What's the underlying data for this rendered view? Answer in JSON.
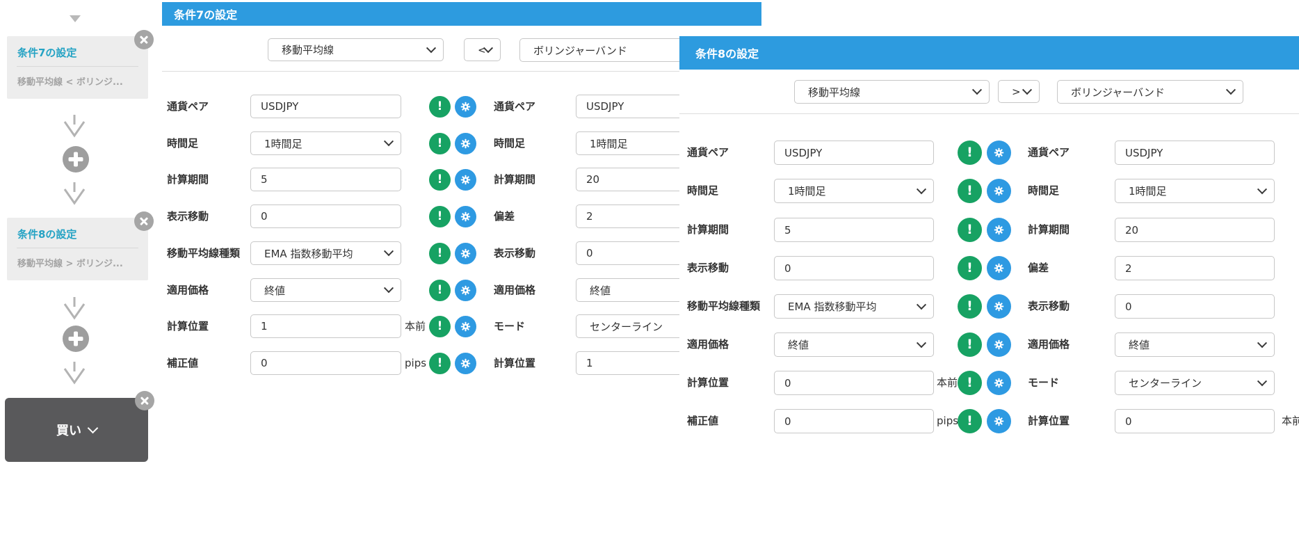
{
  "colors": {
    "header_blue": "#2d9bdf",
    "icon_green": "#17a263",
    "icon_blue": "#2e9ae2",
    "card_title_teal": "#25a3c4",
    "buy_dark_gray": "#59595b"
  },
  "sidebar": {
    "cards": [
      {
        "title": "条件7の設定",
        "summary": "移動平均線 < ボリンジ..."
      },
      {
        "title": "条件8の設定",
        "summary": "移動平均線 > ボリンジ..."
      }
    ],
    "buy_label": "買い",
    "icons": [
      "close-icon",
      "plus-icon",
      "arrow-down-icon",
      "triangle-down-icon"
    ]
  },
  "panels": [
    {
      "title": "条件7の設定",
      "indicator_left": "移動平均線",
      "comparator": "<",
      "indicator_right": "ボリンジャーバンド",
      "left_fields": [
        {
          "label": "通貨ペア",
          "value": "USDJPY",
          "type": "input"
        },
        {
          "label": "時間足",
          "value": "1時間足",
          "type": "select"
        },
        {
          "label": "計算期間",
          "value": "5",
          "type": "input"
        },
        {
          "label": "表示移動",
          "value": "0",
          "type": "input"
        },
        {
          "label": "移動平均線種類",
          "value": "EMA 指数移動平均",
          "type": "select"
        },
        {
          "label": "適用価格",
          "value": "終値",
          "type": "select"
        },
        {
          "label": "計算位置",
          "value": "1",
          "type": "input",
          "suffix": "本前"
        },
        {
          "label": "補正値",
          "value": "0",
          "type": "input",
          "suffix": "pips"
        }
      ],
      "right_fields": [
        {
          "label": "通貨ペア",
          "value": "USDJPY",
          "type": "input"
        },
        {
          "label": "時間足",
          "value": "1時間足",
          "type": "select"
        },
        {
          "label": "計算期間",
          "value": "20",
          "type": "input"
        },
        {
          "label": "偏差",
          "value": "2",
          "type": "input"
        },
        {
          "label": "表示移動",
          "value": "0",
          "type": "input"
        },
        {
          "label": "適用価格",
          "value": "終値",
          "type": "select"
        },
        {
          "label": "モード",
          "value": "センターライン",
          "type": "select"
        },
        {
          "label": "計算位置",
          "value": "1",
          "type": "input"
        }
      ]
    },
    {
      "title": "条件8の設定",
      "indicator_left": "移動平均線",
      "comparator": ">",
      "indicator_right": "ボリンジャーバンド",
      "left_fields": [
        {
          "label": "通貨ペア",
          "value": "USDJPY",
          "type": "input"
        },
        {
          "label": "時間足",
          "value": "1時間足",
          "type": "select"
        },
        {
          "label": "計算期間",
          "value": "5",
          "type": "input"
        },
        {
          "label": "表示移動",
          "value": "0",
          "type": "input"
        },
        {
          "label": "移動平均線種類",
          "value": "EMA 指数移動平均",
          "type": "select"
        },
        {
          "label": "適用価格",
          "value": "終値",
          "type": "select"
        },
        {
          "label": "計算位置",
          "value": "0",
          "type": "input",
          "suffix": "本前"
        },
        {
          "label": "補正値",
          "value": "0",
          "type": "input",
          "suffix": "pips"
        }
      ],
      "right_fields": [
        {
          "label": "通貨ペア",
          "value": "USDJPY",
          "type": "input"
        },
        {
          "label": "時間足",
          "value": "1時間足",
          "type": "select"
        },
        {
          "label": "計算期間",
          "value": "20",
          "type": "input"
        },
        {
          "label": "偏差",
          "value": "2",
          "type": "input"
        },
        {
          "label": "表示移動",
          "value": "0",
          "type": "input"
        },
        {
          "label": "適用価格",
          "value": "終値",
          "type": "select"
        },
        {
          "label": "モード",
          "value": "センターライン",
          "type": "select"
        },
        {
          "label": "計算位置",
          "value": "0",
          "type": "input",
          "suffix": "本前"
        }
      ]
    }
  ]
}
